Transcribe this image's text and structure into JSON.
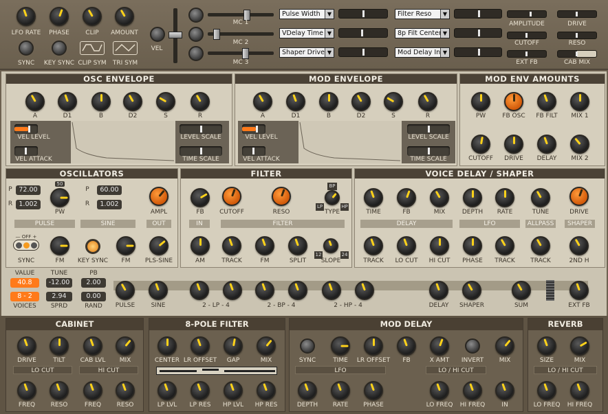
{
  "top": {
    "knob_labels": [
      "LFO RATE",
      "PHASE",
      "CLIP",
      "AMOUNT"
    ],
    "button_labels": [
      "SYNC",
      "KEY SYNC",
      "CLIP SYM",
      "TRI SYM"
    ],
    "vel": "VEL",
    "mc": [
      "MC 1",
      "MC 2",
      "MC 3"
    ],
    "dest_a": [
      "Pulse Width",
      "VDelay Time",
      "Shaper Drive"
    ],
    "dest_b": [
      "Filter Reso",
      "8p Filt Center",
      "Mod Delay In"
    ],
    "right_labels": [
      "AMPLITUDE",
      "DRIVE",
      "CUTOFF",
      "RESO",
      "EXT FB",
      "CAB MIX"
    ]
  },
  "osc_env": {
    "title": "OSC ENVELOPE",
    "knobs": [
      "A",
      "D1",
      "B",
      "D2",
      "S",
      "R"
    ],
    "vel_level": "VEL LEVEL",
    "vel_attack": "VEL ATTACK",
    "level_scale": "LEVEL SCALE",
    "time_scale": "TIME SCALE"
  },
  "mod_env": {
    "title": "MOD ENVELOPE",
    "knobs": [
      "A",
      "D1",
      "B",
      "D2",
      "S",
      "R"
    ],
    "vel_level": "VEL LEVEL",
    "vel_attack": "VEL ATTACK",
    "level_scale": "LEVEL SCALE",
    "time_scale": "TIME SCALE"
  },
  "mod_env_amounts": {
    "title": "MOD ENV AMOUNTS",
    "row1": [
      "PW",
      "FB OSC",
      "FB FILT",
      "MIX 1"
    ],
    "row2": [
      "CUTOFF",
      "DRIVE",
      "DELAY",
      "MIX 2"
    ]
  },
  "oscillators": {
    "title": "OSCILLATORS",
    "p1": "72.00",
    "r1": "1.002",
    "p2": "60.00",
    "r2": "1.002",
    "p_label": "P",
    "r_label": "R",
    "badge": "50",
    "pw": "PW",
    "ampl": "AMPL",
    "pulse": "PULSE",
    "sine": "SINE",
    "out": "OUT",
    "sync_switch": "— OFF +",
    "sync": "SYNC",
    "fm1": "FM",
    "key_sync": "KEY SYNC",
    "fm2": "FM",
    "pls_sine": "PLS-SINE"
  },
  "filter": {
    "title": "FILTER",
    "fb": "FB",
    "cutoff": "CUTOFF",
    "reso": "RESO",
    "type": "TYPE",
    "type_marks": [
      "BP",
      "LP",
      "HP"
    ],
    "in": "IN",
    "filter": "FILTER",
    "am": "AM",
    "track": "TRACK",
    "fm": "FM",
    "split": "SPLIT",
    "slope": "SLOPE",
    "slope_marks": [
      "12",
      "24"
    ]
  },
  "voice_delay": {
    "title": "VOICE DELAY / SHAPER",
    "row1": [
      "TIME",
      "FB",
      "MIX",
      "DEPTH",
      "RATE",
      "TUNE",
      "DRIVE"
    ],
    "groups": [
      "DELAY",
      "LFO",
      "ALLPASS",
      "SHAPER"
    ],
    "row2": [
      "TRACK",
      "LO CUT",
      "HI CUT",
      "PHASE",
      "TRACK",
      "TRACK",
      "2ND H"
    ]
  },
  "voice": {
    "value_label": "VALUE",
    "value": "40.8",
    "tune_label": "TUNE",
    "tune": "-12.00",
    "pb_label": "PB",
    "pb": "2.00",
    "voices_value": "8 - 2",
    "voices_label": "VOICES",
    "sprd_value": "2.94",
    "sprd_label": "SPRD",
    "rand_value": "0.00",
    "rand_label": "RAND"
  },
  "mixer": {
    "labels": [
      "PULSE",
      "SINE",
      "2 - LP - 4",
      "2 - BP - 4",
      "2 - HP - 4",
      "DELAY",
      "SHAPER",
      "SUM",
      "EXT FB"
    ]
  },
  "cabinet": {
    "title": "CABINET",
    "row1": [
      "DRIVE",
      "TILT",
      "CAB LVL",
      "MIX"
    ],
    "lo_cut": "LO CUT",
    "hi_cut": "HI CUT",
    "row2": [
      "FREQ",
      "RESO",
      "FREQ",
      "RESO"
    ]
  },
  "pole_filter": {
    "title": "8-POLE FILTER",
    "row1": [
      "CENTER",
      "LR OFFSET",
      "GAP",
      "MIX"
    ],
    "row2": [
      "LP LVL",
      "LP RES",
      "HP LVL",
      "HP RES"
    ]
  },
  "mod_delay": {
    "title": "MOD DELAY",
    "row1": [
      "SYNC",
      "TIME",
      "LR OFFSET",
      "FB",
      "X AMT",
      "INVERT",
      "MIX"
    ],
    "lfo": "LFO",
    "lohi": "LO / HI CUT",
    "row2": [
      "DEPTH",
      "RATE",
      "PHASE",
      "LO FREQ",
      "HI FREQ",
      "IN"
    ]
  },
  "reverb": {
    "title": "REVERB",
    "row1": [
      "SIZE",
      "MIX"
    ],
    "lohi": "LO / HI CUT",
    "row2": [
      "LO FREQ",
      "HI FREQ"
    ]
  }
}
